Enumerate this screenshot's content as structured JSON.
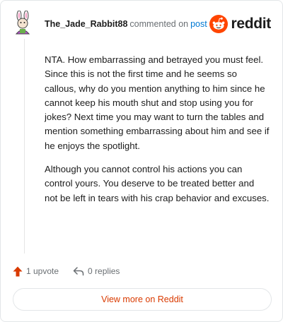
{
  "comment": {
    "username": "The_Jade_Rabbit88",
    "commented_on": "commented on",
    "post_link": "post",
    "paragraphs": [
      "NTA. How embarrassing and betrayed you must feel. Since this is not the first time and he seems so callous, why do you mention anything to him since he cannot keep his mouth shut and stop using you for jokes? Next time you may want to turn the tables and mention something embarrassing about him and see if he enjoys the spotlight.",
      "Although you cannot control his actions you can control yours. You deserve to be treated better and not be left in tears with his crap behavior and excuses."
    ]
  },
  "brand": {
    "wordmark": "reddit",
    "accent": "#ff4500"
  },
  "actions": {
    "upvotes": "1 upvote",
    "replies": "0 replies",
    "upvote_color": "#d93a00"
  },
  "view_more_label": "View more on Reddit",
  "icons": {
    "avatar": "rabbit-avatar-icon",
    "upvote": "upvote-arrow-icon",
    "reply": "reply-arrow-icon",
    "logo": "reddit-snoo-icon"
  }
}
